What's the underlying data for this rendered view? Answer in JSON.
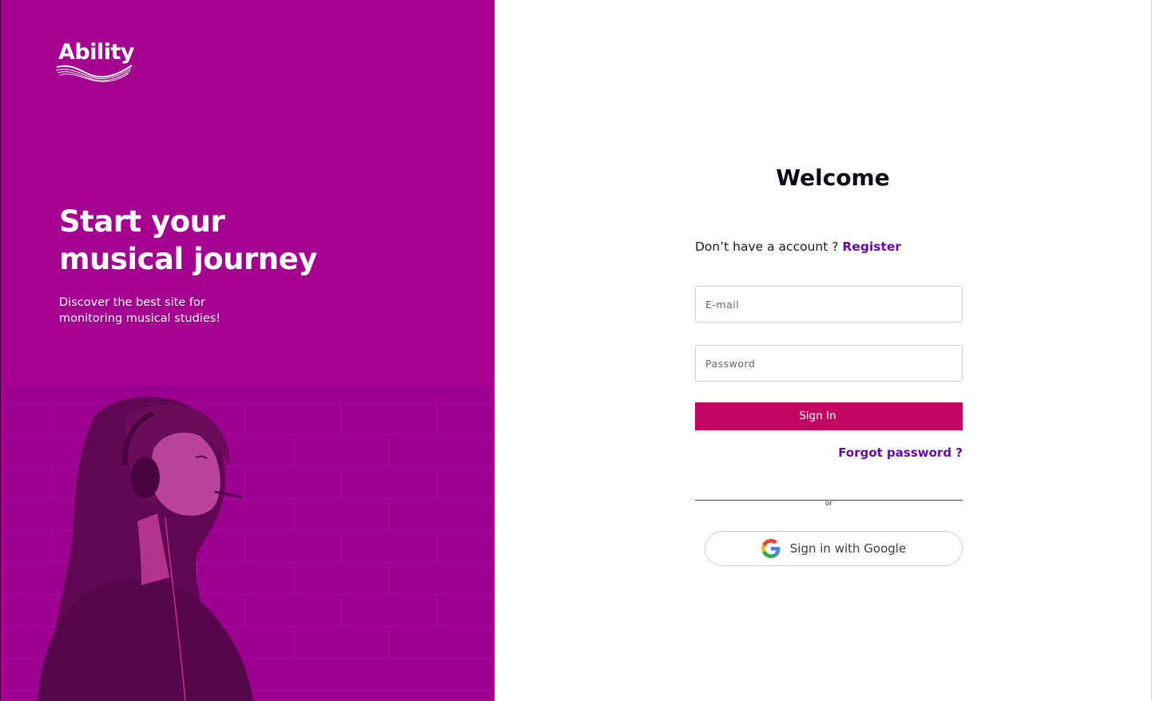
{
  "brand": {
    "name": "Ability"
  },
  "hero": {
    "headline_line1": "Start your",
    "headline_line2": "musical journey",
    "subline_line1": "Discover the best site for",
    "subline_line2": "monitoring musical studies!"
  },
  "form": {
    "title": "Welcome",
    "no_account_text": "Don’t have a account ?",
    "register_label": "Register",
    "email_placeholder": "E-mail",
    "password_placeholder": "Password",
    "signin_label": "Sign In",
    "forgot_label": "Forgot password ?",
    "or_text": "or",
    "google_label": "Sign in with Google"
  },
  "colors": {
    "hero_bg": "#a5008f",
    "signin_bg": "#c10761",
    "link": "#6a0aa8"
  },
  "icons": [
    "google-g-icon"
  ]
}
